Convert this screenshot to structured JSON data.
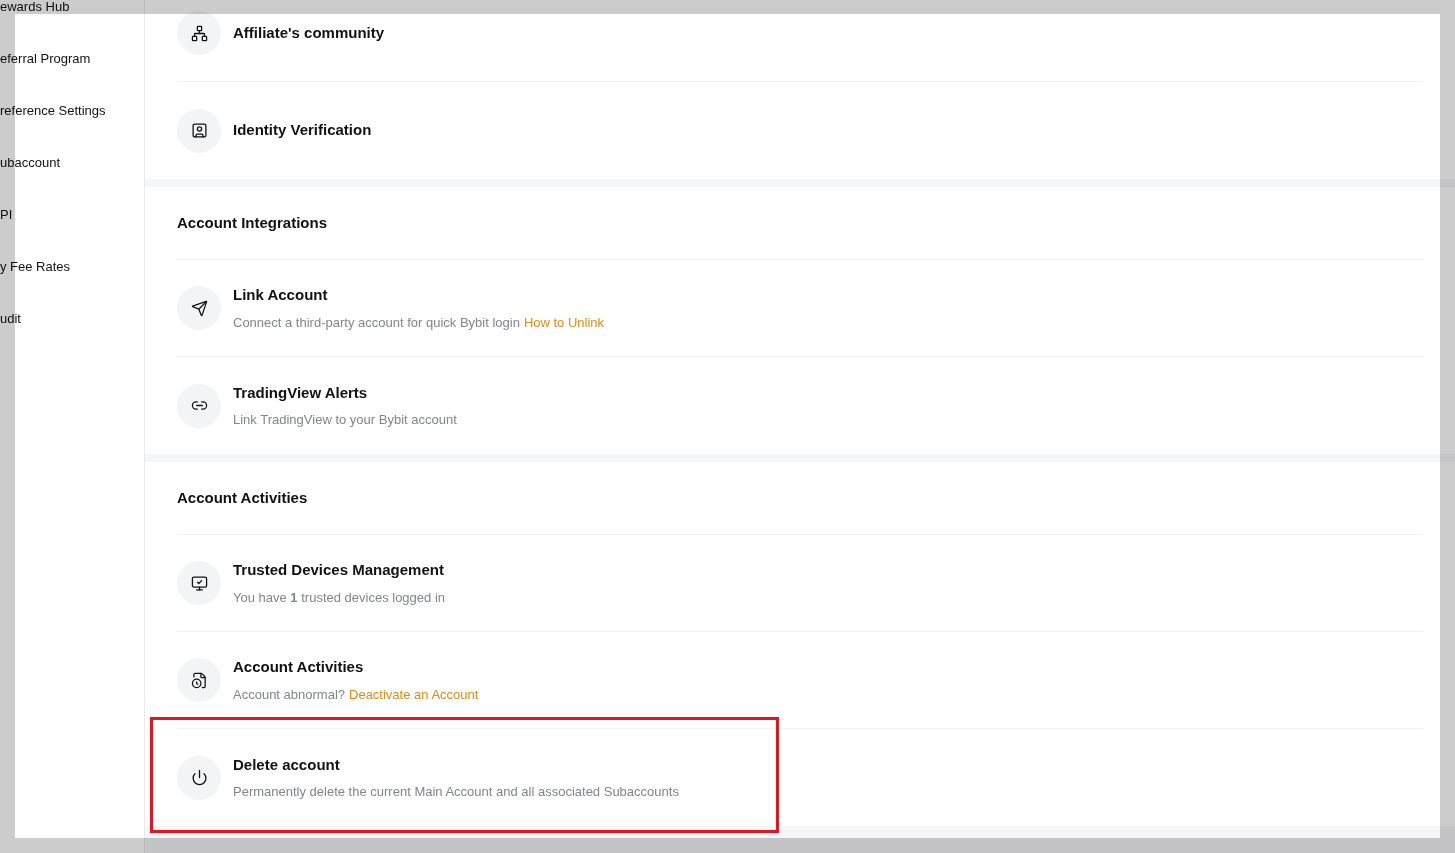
{
  "sidebar": {
    "items": [
      {
        "label": "ewards Hub"
      },
      {
        "label": "eferral Program"
      },
      {
        "label": "reference Settings"
      },
      {
        "label": "ubaccount"
      },
      {
        "label": "PI"
      },
      {
        "label": "y Fee Rates"
      },
      {
        "label": "udit"
      }
    ]
  },
  "sections": [
    {
      "rows": [
        {
          "title": "Affiliate's community",
          "highlighted": false
        },
        {
          "title": "Identity Verification",
          "highlighted": false
        }
      ]
    },
    {
      "title": "Account Integrations",
      "rows": [
        {
          "title": "Link Account",
          "description": "Connect a third-party account for quick Bybit login",
          "link": "How to Unlink",
          "highlighted": false
        },
        {
          "title": "TradingView Alerts",
          "description": "Link TradingView to your Bybit account",
          "highlighted": false
        }
      ]
    },
    {
      "title": "Account Activities",
      "rows": [
        {
          "title": "Trusted Devices Management",
          "description": "You have **1** trusted devices logged in",
          "highlighted": false
        },
        {
          "title": "Account Activities",
          "description": "Account abnormal?",
          "link": "Deactivate an Account",
          "highlighted": false
        },
        {
          "title": "Delete account",
          "description": "Permanently delete the current Main Account and all associated Subaccounts",
          "highlighted": true
        }
      ]
    }
  ]
}
